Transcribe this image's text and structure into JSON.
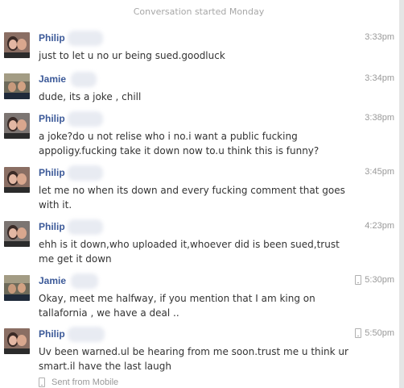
{
  "conversation_start": "Conversation started Monday",
  "messages": [
    {
      "sender": "Philip",
      "time": "3:33pm",
      "text": "just to let u no ur being sued.goodluck"
    },
    {
      "sender": "Jamie",
      "time": "3:34pm",
      "text": "dude, its a joke , chill"
    },
    {
      "sender": "Philip",
      "time": "3:38pm",
      "text": "a joke?do u not relise who i no.i want a public fucking appoligy.fucking take it down now to.u think this is funny?"
    },
    {
      "sender": "Philip",
      "time": "3:45pm",
      "text": "let me no when its down and every fucking comment that goes with it."
    },
    {
      "sender": "Philip",
      "time": "4:23pm",
      "text": "ehh is it down,who uploaded it,whoever did is been sued,trust me get it down"
    },
    {
      "sender": "Jamie",
      "time": "5:30pm",
      "text": "Okay, meet me halfway, if you mention that I am king on tallafornia , we have a deal .."
    },
    {
      "sender": "Philip",
      "time": "5:50pm",
      "text": "Uv been warned.ul be hearing from me soon.trust me u think ur smart.il have the last laugh"
    }
  ],
  "footer": {
    "sent_from": "Sent from Mobile"
  },
  "icons": {
    "mobile": "phone-icon"
  }
}
